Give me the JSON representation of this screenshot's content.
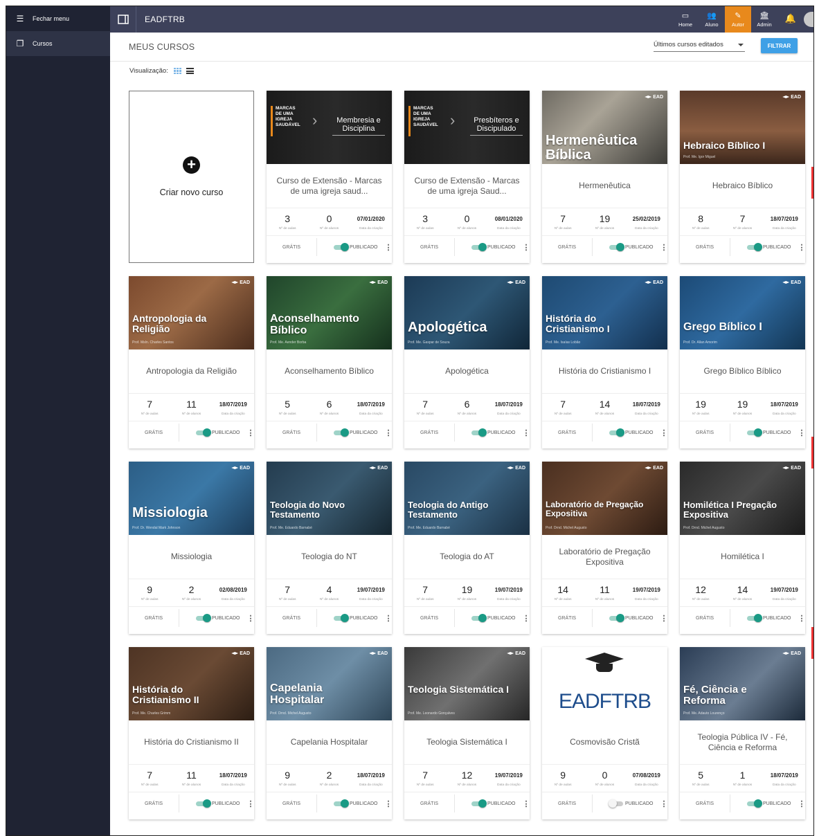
{
  "sidebar": {
    "close_menu": "Fechar menu",
    "courses": "Cursos"
  },
  "topbar": {
    "brand": "EADFTRB",
    "nav": [
      {
        "label": "Home",
        "icon": "monitor-icon"
      },
      {
        "label": "Aluno",
        "icon": "users-icon"
      },
      {
        "label": "Autor",
        "icon": "pencil-icon",
        "active": true
      },
      {
        "label": "Admin",
        "icon": "bank-icon"
      }
    ]
  },
  "page": {
    "title": "MEUS CURSOS",
    "sort_value": "Últimos cursos editados",
    "filter": "FILTRAR",
    "visualization": "Visualização:",
    "new_course": "Criar novo curso"
  },
  "labels": {
    "lessons": "Nº de aulas",
    "students": "Nº de alunos",
    "date": "Data da criação",
    "free": "GRÁTIS",
    "published": "PUBLICADO"
  },
  "courses": [
    {
      "title": "Curso de Extensão - Marcas de uma igreja saud...",
      "lessons": "3",
      "students": "0",
      "date": "07/01/2020",
      "img_text": "Membresia e Disciplina",
      "published": true
    },
    {
      "title": "Curso de Extensão - Marcas de uma igreja Saud...",
      "lessons": "3",
      "students": "0",
      "date": "08/01/2020",
      "img_text": "Presbíteros e Discipulado",
      "published": true
    },
    {
      "title": "Hermenêutica",
      "lessons": "7",
      "students": "19",
      "date": "25/02/2019",
      "img_text": "Hermenêutica Bíblica",
      "prof": "Prof. Me. Isaías Lobão",
      "published": true
    },
    {
      "title": "Hebraico Bíblico",
      "lessons": "8",
      "students": "7",
      "date": "18/07/2019",
      "img_text": "Hebraico Bíblico I",
      "prof": "Prof. Me. Igor Miguel",
      "published": true
    },
    {
      "title": "Antropologia da Religião",
      "lessons": "7",
      "students": "11",
      "date": "18/07/2019",
      "img_text": "Antropologia da Religião",
      "prof": "Prof. MsIn. Charles Santos",
      "published": true
    },
    {
      "title": "Aconselhamento Bíblico",
      "lessons": "5",
      "students": "6",
      "date": "18/07/2019",
      "img_text": "Aconselhamento Bíblico",
      "prof": "Prof. Me. Aender Borba",
      "published": true
    },
    {
      "title": "Apologética",
      "lessons": "7",
      "students": "6",
      "date": "18/07/2019",
      "img_text": "Apologética",
      "prof": "Prof. Me. Gaspar de Souza",
      "published": true
    },
    {
      "title": "História do Cristianismo I",
      "lessons": "7",
      "students": "14",
      "date": "18/07/2019",
      "img_text": "História do Cristianismo I",
      "prof": "Prof. Me. Isaías Lobão",
      "published": true
    },
    {
      "title": "Grego Bíblico Bíblico",
      "lessons": "19",
      "students": "19",
      "date": "18/07/2019",
      "img_text": "Grego Bíblico I",
      "prof": "Prof. Dr. Allan Amorim",
      "published": true
    },
    {
      "title": "Missiologia",
      "lessons": "9",
      "students": "2",
      "date": "02/08/2019",
      "img_text": "Missiologia",
      "prof": "Prof. Dr. Wendal Mark Johnson",
      "published": true
    },
    {
      "title": "Teologia do NT",
      "lessons": "7",
      "students": "4",
      "date": "19/07/2019",
      "img_text": "Teologia do Novo Testamento",
      "prof": "Prof. Me. Eduardo Barnabé",
      "published": true
    },
    {
      "title": "Teologia do AT",
      "lessons": "7",
      "students": "19",
      "date": "19/07/2019",
      "img_text": "Teologia do Antigo Testamento",
      "prof": "Prof. Me. Eduardo Barnabé",
      "published": true
    },
    {
      "title": "Laboratório de Pregação Expositiva",
      "lessons": "14",
      "students": "11",
      "date": "19/07/2019",
      "img_text": "Laboratório de Pregação Expositiva",
      "prof": "Prof. Drnd. Michel Augusto",
      "published": true
    },
    {
      "title": "Homilética I",
      "lessons": "12",
      "students": "14",
      "date": "19/07/2019",
      "img_text": "Homilética I Pregação Expositiva",
      "prof": "Prof. Drnd. Michel Augusto",
      "published": true
    },
    {
      "title": "História do Cristianismo II",
      "lessons": "7",
      "students": "11",
      "date": "18/07/2019",
      "img_text": "História do Cristianismo II",
      "prof": "Prof. Me. Charles Grimm",
      "published": true
    },
    {
      "title": "Capelania Hospitalar",
      "lessons": "9",
      "students": "2",
      "date": "18/07/2019",
      "img_text": "Capelania Hospitalar",
      "prof": "Prof. Drnd. Michel Augusto",
      "published": true
    },
    {
      "title": "Teologia Sistemática I",
      "lessons": "7",
      "students": "12",
      "date": "19/07/2019",
      "img_text": "Teologia Sistemática I",
      "prof": "Prof. Me. Leonardo Gonçalves",
      "published": true
    },
    {
      "title": "Cosmovisão Cristã",
      "lessons": "9",
      "students": "0",
      "date": "07/08/2019",
      "img_text": "EADFTRB",
      "published": false
    },
    {
      "title": "Teologia Pública IV - Fé, Ciência e Reforma",
      "lessons": "5",
      "students": "1",
      "date": "18/07/2019",
      "img_text": "Fé, Ciência e Reforma",
      "prof": "Prof. Me. Adauto Lourenço",
      "published": true
    }
  ],
  "colors": {
    "accent": "#e8891c",
    "primary": "#3fa0e6",
    "toggle": "#1a9a85",
    "sidebar": "#1f2333",
    "topbar": "#3d415a"
  }
}
